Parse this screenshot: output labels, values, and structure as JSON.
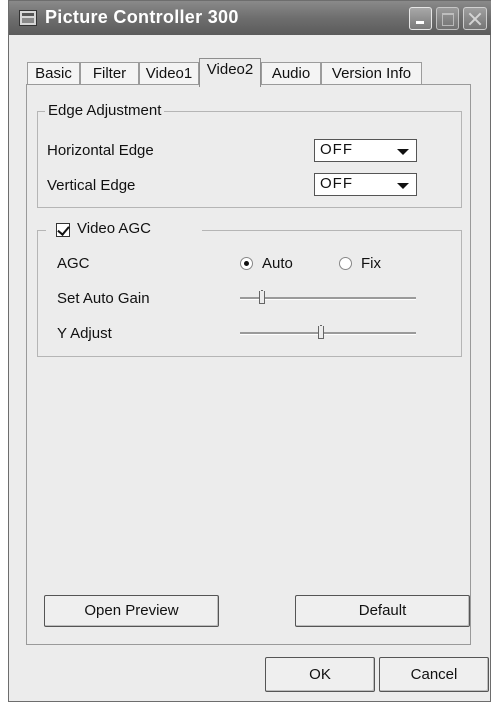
{
  "window": {
    "title": "Picture Controller 300"
  },
  "tabs": [
    {
      "label": "Basic"
    },
    {
      "label": "Filter"
    },
    {
      "label": "Video1"
    },
    {
      "label": "Video2"
    },
    {
      "label": "Audio"
    },
    {
      "label": "Version Info"
    }
  ],
  "active_tab": "Video2",
  "edge": {
    "group_title": "Edge Adjustment",
    "horizontal_label": "Horizontal Edge",
    "horizontal_value": "OFF",
    "vertical_label": "Vertical Edge",
    "vertical_value": "OFF"
  },
  "agc": {
    "checkbox_label": "Video AGC",
    "checked": true,
    "agc_label": "AGC",
    "radio_auto": "Auto",
    "radio_fix": "Fix",
    "selected": "Auto",
    "set_auto_gain_label": "Set Auto Gain",
    "set_auto_gain_level": 0.11,
    "y_adjust_label": "Y Adjust",
    "y_adjust_level": 0.46
  },
  "buttons": {
    "open_preview": "Open Preview",
    "default": "Default",
    "ok": "OK",
    "cancel": "Cancel"
  }
}
